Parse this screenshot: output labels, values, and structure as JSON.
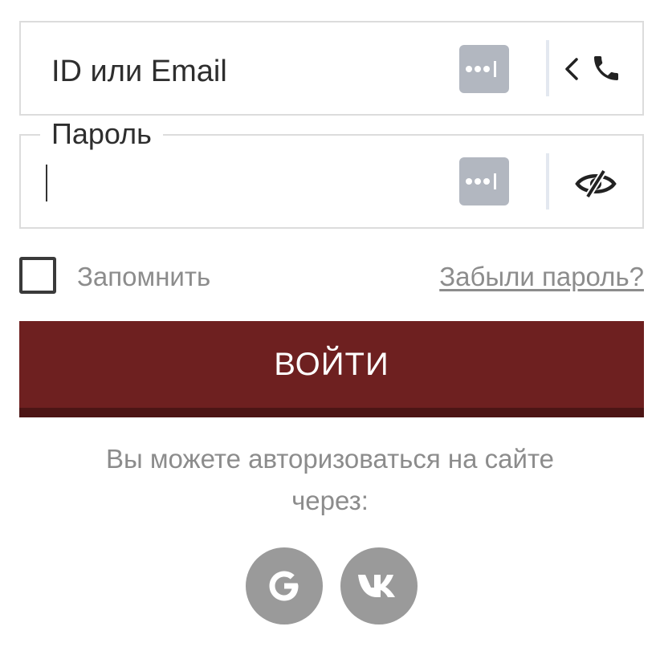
{
  "login_field": {
    "placeholder": "ID или Email",
    "password_manager_icon": "password-manager-icon",
    "toggle_icon": "chevron-left-icon",
    "phone_icon": "phone-icon"
  },
  "password_field": {
    "label": "Пароль",
    "value": "",
    "password_manager_icon": "password-manager-icon",
    "visibility_icon": "eye-slash-icon"
  },
  "remember": {
    "label": "Запомнить",
    "checked": false
  },
  "forgot_password": {
    "label": "Забыли пароль?"
  },
  "submit": {
    "label": "ВОЙТИ"
  },
  "social": {
    "text_line1": "Вы можете авторизоваться на сайте",
    "text_line2": "через:",
    "providers": [
      "google-icon",
      "vk-icon"
    ]
  },
  "colors": {
    "primary_button": "#6e2020",
    "primary_button_shadow": "#4c1515",
    "muted_text": "#8c8c8c",
    "border": "#dcdcdc",
    "social_icon_bg": "#9a9a9a",
    "password_manager_bg": "#b2b7c0"
  }
}
